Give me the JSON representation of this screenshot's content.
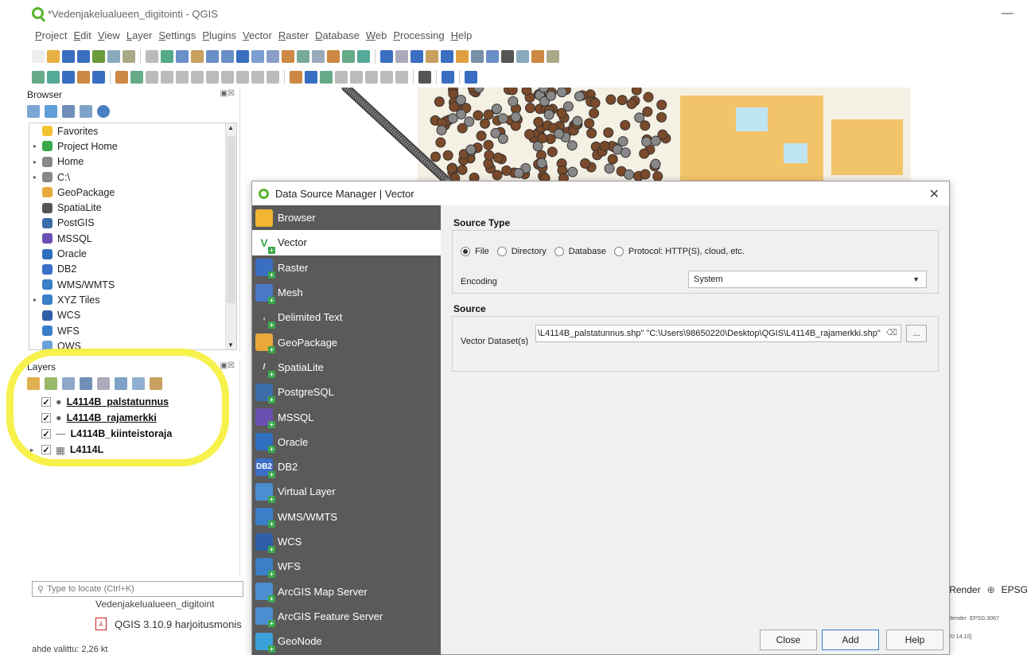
{
  "window": {
    "title": "*Vedenjakelualueen_digitointi - QGIS",
    "minimize": "—"
  },
  "menu": [
    "Project",
    "Edit",
    "View",
    "Layer",
    "Settings",
    "Plugins",
    "Vector",
    "Raster",
    "Database",
    "Web",
    "Processing",
    "Help"
  ],
  "browser_panel": {
    "title": "Browser",
    "items": [
      {
        "label": "Favorites",
        "icon": "star-icon",
        "arrow": ""
      },
      {
        "label": "Project Home",
        "icon": "folder-home-icon",
        "arrow": "▸"
      },
      {
        "label": "Home",
        "icon": "home-folder-icon",
        "arrow": "▸"
      },
      {
        "label": "C:\\",
        "icon": "drive-icon",
        "arrow": "▸"
      },
      {
        "label": "GeoPackage",
        "icon": "geopackage-icon",
        "arrow": ""
      },
      {
        "label": "SpatiaLite",
        "icon": "spatialite-icon",
        "arrow": ""
      },
      {
        "label": "PostGIS",
        "icon": "postgis-icon",
        "arrow": ""
      },
      {
        "label": "MSSQL",
        "icon": "mssql-icon",
        "arrow": ""
      },
      {
        "label": "Oracle",
        "icon": "oracle-icon",
        "arrow": ""
      },
      {
        "label": "DB2",
        "icon": "db2-icon",
        "arrow": ""
      },
      {
        "label": "WMS/WMTS",
        "icon": "wms-icon",
        "arrow": ""
      },
      {
        "label": "XYZ Tiles",
        "icon": "xyz-icon",
        "arrow": "▸"
      },
      {
        "label": "WCS",
        "icon": "wcs-icon",
        "arrow": ""
      },
      {
        "label": "WFS",
        "icon": "wfs-icon",
        "arrow": ""
      },
      {
        "label": "OWS",
        "icon": "ows-icon",
        "arrow": ""
      }
    ]
  },
  "layers_panel": {
    "title": "Layers",
    "layers": [
      {
        "name": "L4114B_palstatunnus",
        "symbol": "●",
        "arrow": ""
      },
      {
        "name": "L4114B_rajamerkki",
        "symbol": "●",
        "arrow": ""
      },
      {
        "name": "L4114B_kiinteistoraja",
        "symbol": "—",
        "arrow": ""
      },
      {
        "name": "L4114L",
        "symbol": "▦",
        "arrow": "▸"
      }
    ]
  },
  "locator": {
    "placeholder": "Type to locate (Ctrl+K)"
  },
  "status": {
    "render": "Render",
    "crs": "EPSG"
  },
  "background": {
    "item1": "Vedenjakelualueen_digitoint",
    "item2": "QGIS 3.10.9 harjoitusmonis",
    "status": "ahde valittu: 2,26 kt",
    "mini_render": "Render",
    "mini_epsg": "EPSG:3067",
    "mini_time": "20 14.10]"
  },
  "dialog": {
    "title": "Data Source Manager | Vector",
    "close": "✕",
    "sidebar": [
      {
        "label": "Browser",
        "icon": "folder-icon",
        "color": "#f2b632",
        "glyph": ""
      },
      {
        "label": "Vector",
        "icon": "vector-icon",
        "color": "#ffffff",
        "glyph": "V"
      },
      {
        "label": "Raster",
        "icon": "raster-icon",
        "color": "#3a6ec0",
        "glyph": ""
      },
      {
        "label": "Mesh",
        "icon": "mesh-icon",
        "color": "#4a78c6",
        "glyph": ""
      },
      {
        "label": "Delimited Text",
        "icon": "delimited-text-icon",
        "color": "#5a5a5a",
        "glyph": ","
      },
      {
        "label": "GeoPackage",
        "icon": "geopackage-icon",
        "color": "#e8a83b",
        "glyph": ""
      },
      {
        "label": "SpatiaLite",
        "icon": "spatialite-icon",
        "color": "#5a5a5a",
        "glyph": "/"
      },
      {
        "label": "PostgreSQL",
        "icon": "postgresql-icon",
        "color": "#3b6ea8",
        "glyph": ""
      },
      {
        "label": "MSSQL",
        "icon": "mssql-icon",
        "color": "#6b4fb0",
        "glyph": ""
      },
      {
        "label": "Oracle",
        "icon": "oracle-icon",
        "color": "#2f6fbf",
        "glyph": ""
      },
      {
        "label": "DB2",
        "icon": "db2-icon",
        "color": "#3b6ec8",
        "glyph": "DB2"
      },
      {
        "label": "Virtual Layer",
        "icon": "virtual-layer-icon",
        "color": "#4a8fd0",
        "glyph": ""
      },
      {
        "label": "WMS/WMTS",
        "icon": "wms-icon",
        "color": "#3a7fc8",
        "glyph": ""
      },
      {
        "label": "WCS",
        "icon": "wcs-icon",
        "color": "#2f5fa8",
        "glyph": ""
      },
      {
        "label": "WFS",
        "icon": "wfs-icon",
        "color": "#3a7fc8",
        "glyph": ""
      },
      {
        "label": "ArcGIS Map Server",
        "icon": "arcgis-map-icon",
        "color": "#4a8fd0",
        "glyph": ""
      },
      {
        "label": "ArcGIS Feature Server",
        "icon": "arcgis-feature-icon",
        "color": "#4a8fd0",
        "glyph": ""
      },
      {
        "label": "GeoNode",
        "icon": "geonode-icon",
        "color": "#3aa0d8",
        "glyph": ""
      }
    ],
    "source_type": {
      "title": "Source Type",
      "options": [
        "File",
        "Directory",
        "Database",
        "Protocol: HTTP(S), cloud, etc."
      ],
      "selected": "File",
      "encoding_label": "Encoding",
      "encoding_value": "System"
    },
    "source": {
      "title": "Source",
      "dataset_label": "Vector Dataset(s)",
      "dataset_value": "\\L4114B_palstatunnus.shp\" \"C:\\Users\\98650220\\Desktop\\QGIS\\L4114B_rajamerkki.shp\"",
      "browse": "..."
    },
    "buttons": {
      "close": "Close",
      "add": "Add",
      "help": "Help"
    }
  }
}
